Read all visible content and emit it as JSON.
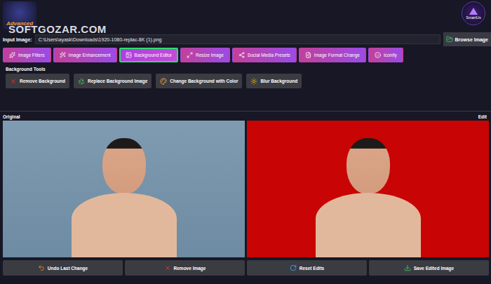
{
  "watermark": "SOFTGOZAR.COM",
  "logo": {
    "text": "Advanced"
  },
  "brand": {
    "text": "SmartUs"
  },
  "input": {
    "label": "Input Image:",
    "value": "C:\\Users\\ayask\\Downloads\\1920-1080-replac-8K (1).png",
    "button": "Browse Image"
  },
  "tabs": [
    {
      "label": "Image Filters",
      "selected": false
    },
    {
      "label": "Image Enhancement",
      "selected": false
    },
    {
      "label": "Background Editor",
      "selected": true
    },
    {
      "label": "Resize Image",
      "selected": false
    },
    {
      "label": "Social Media Presets",
      "selected": false
    },
    {
      "label": "Image Format Change",
      "selected": false
    },
    {
      "label": "Iconify",
      "selected": false
    }
  ],
  "tools": {
    "title": "Background Tools",
    "buttons": [
      "Remove Background",
      "Replace Background Image",
      "Change Background with Color",
      "Blur Background"
    ]
  },
  "panels": {
    "original": "Original",
    "edited": "Edit"
  },
  "actions": [
    "Undo Last Change",
    "Remove Image",
    "Reset Edits",
    "Save Edited Image"
  ]
}
